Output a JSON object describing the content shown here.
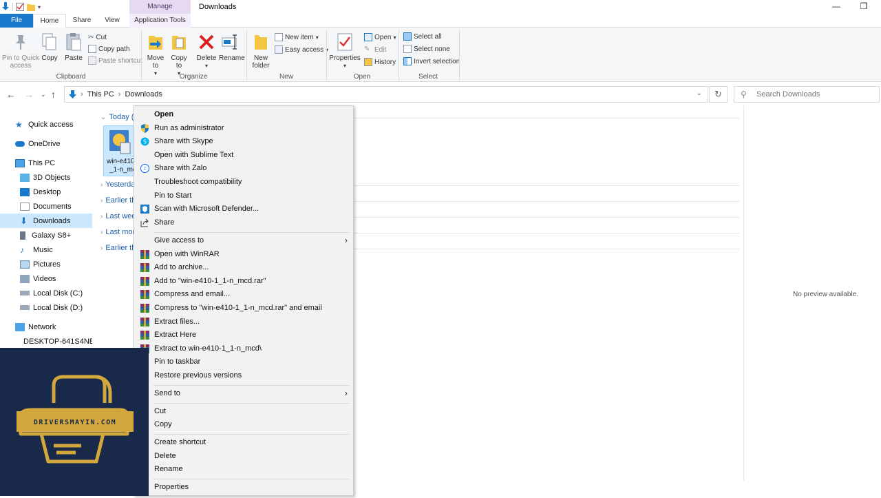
{
  "window": {
    "title": "Downloads",
    "manage_tab": "Manage"
  },
  "ribbon": {
    "tabs": [
      "File",
      "Home",
      "Share",
      "View",
      "Application Tools"
    ],
    "clipboard": {
      "pin": "Pin to Quick access",
      "copy": "Copy",
      "paste": "Paste",
      "cut": "Cut",
      "copy_path": "Copy path",
      "paste_shortcut": "Paste shortcut",
      "label": "Clipboard"
    },
    "organize": {
      "move_to": "Move to",
      "copy_to": "Copy to",
      "delete": "Delete",
      "rename": "Rename",
      "label": "Organize"
    },
    "new": {
      "new_folder": "New folder",
      "new_item": "New item",
      "easy_access": "Easy access",
      "label": "New"
    },
    "open": {
      "properties": "Properties",
      "open": "Open",
      "edit": "Edit",
      "history": "History",
      "label": "Open"
    },
    "select": {
      "select_all": "Select all",
      "select_none": "Select none",
      "invert": "Invert selection",
      "label": "Select"
    }
  },
  "address": {
    "crumbs": [
      "This PC",
      "Downloads"
    ],
    "search_placeholder": "Search Downloads"
  },
  "navpane": {
    "items": [
      {
        "label": "Quick access",
        "icon": "star-icon"
      },
      {
        "label": "OneDrive",
        "icon": "cloud-icon"
      },
      {
        "label": "This PC",
        "icon": "computer-icon"
      },
      {
        "label": "3D Objects",
        "icon": "cube-icon"
      },
      {
        "label": "Desktop",
        "icon": "desktop-icon"
      },
      {
        "label": "Documents",
        "icon": "documents-icon"
      },
      {
        "label": "Downloads",
        "icon": "download-icon"
      },
      {
        "label": "Galaxy S8+",
        "icon": "phone-icon"
      },
      {
        "label": "Music",
        "icon": "music-icon"
      },
      {
        "label": "Pictures",
        "icon": "pictures-icon"
      },
      {
        "label": "Videos",
        "icon": "videos-icon"
      },
      {
        "label": "Local Disk (C:)",
        "icon": "disk-icon"
      },
      {
        "label": "Local Disk (D:)",
        "icon": "disk-icon"
      },
      {
        "label": "Network",
        "icon": "network-icon"
      },
      {
        "label": "DESKTOP-641S4NE",
        "icon": "computer-icon"
      }
    ],
    "selected": "Downloads"
  },
  "content": {
    "groups": [
      "Today (1",
      "Yesterda",
      "Earlier th",
      "Last wee",
      "Last mon",
      "Earlier th"
    ],
    "file": {
      "name_line1": "win-e410",
      "name_line2": "_1-n_mc"
    }
  },
  "preview": {
    "message": "No preview available."
  },
  "context_menu": {
    "items": [
      {
        "label": "Open",
        "icon": "",
        "bold": true
      },
      {
        "label": "Run as administrator",
        "icon": "shield-icon"
      },
      {
        "label": "Share with Skype",
        "icon": "skype-icon"
      },
      {
        "label": "Open with Sublime Text",
        "icon": ""
      },
      {
        "label": "Share with Zalo",
        "icon": "zalo-icon"
      },
      {
        "label": "Troubleshoot compatibility",
        "icon": ""
      },
      {
        "label": "Pin to Start",
        "icon": ""
      },
      {
        "label": "Scan with Microsoft Defender...",
        "icon": "defender-icon"
      },
      {
        "label": "Share",
        "icon": "share-icon"
      },
      {
        "label": "Give access to",
        "icon": "",
        "submenu": true
      },
      {
        "label": "Open with WinRAR",
        "icon": "winrar-icon"
      },
      {
        "label": "Add to archive...",
        "icon": "winrar-icon"
      },
      {
        "label": "Add to \"win-e410-1_1-n_mcd.rar\"",
        "icon": "winrar-icon"
      },
      {
        "label": "Compress and email...",
        "icon": "winrar-icon"
      },
      {
        "label": "Compress to \"win-e410-1_1-n_mcd.rar\" and email",
        "icon": "winrar-icon"
      },
      {
        "label": "Extract files...",
        "icon": "winrar-icon"
      },
      {
        "label": "Extract Here",
        "icon": "winrar-icon"
      },
      {
        "label": "Extract to win-e410-1_1-n_mcd\\",
        "icon": "winrar-icon"
      },
      {
        "label": "Pin to taskbar",
        "icon": ""
      },
      {
        "label": "Restore previous versions",
        "icon": ""
      },
      {
        "label": "Send to",
        "icon": "",
        "submenu": true
      },
      {
        "label": "Cut",
        "icon": ""
      },
      {
        "label": "Copy",
        "icon": ""
      },
      {
        "label": "Create shortcut",
        "icon": ""
      },
      {
        "label": "Delete",
        "icon": ""
      },
      {
        "label": "Rename",
        "icon": ""
      },
      {
        "label": "Properties",
        "icon": ""
      }
    ]
  },
  "watermark": {
    "text": "DRIVERSMAYIN.COM"
  },
  "colors": {
    "accent": "#1979ca",
    "selection": "#cce8ff",
    "watermark_bg": "#18294a",
    "watermark_gold": "#d4a73c"
  }
}
